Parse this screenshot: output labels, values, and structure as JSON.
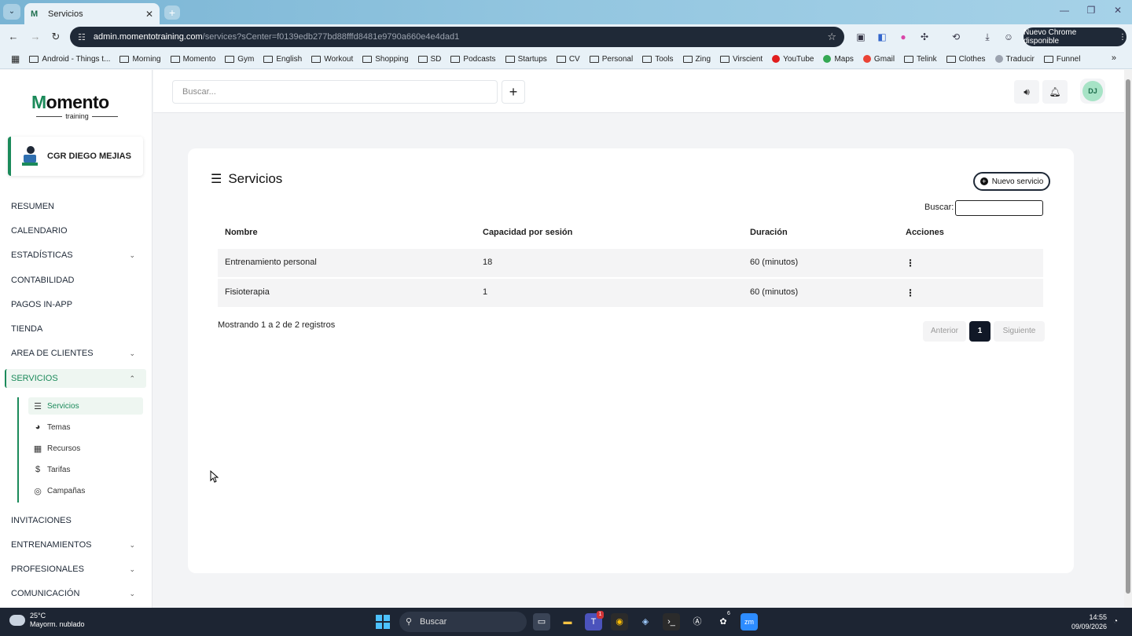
{
  "browser": {
    "tab_title": "Servicios",
    "url_host": "admin.momentotraining.com",
    "url_path": "/services?sCenter=f0139edb277bd88fffd8481e9790a660e4e4dad1",
    "update_label": "Nuevo Chrome disponible",
    "bookmarks": [
      "Android - Things t...",
      "Morning",
      "Momento",
      "Gym",
      "English",
      "Workout",
      "Shopping",
      "SD",
      "Podcasts",
      "Startups",
      "CV",
      "Personal",
      "Tools",
      "Zing",
      "Virscient",
      "YouTube",
      "Maps",
      "Gmail",
      "Telink",
      "Clothes",
      "Traducir",
      "Funnel"
    ]
  },
  "brand": {
    "logo_m": "M",
    "logo_rest": "omento",
    "logo_sub": "training"
  },
  "center": {
    "name": "CGR DIEGO MEJIAS"
  },
  "nav": {
    "resumen": "RESUMEN",
    "calendario": "CALENDARIO",
    "estadisticas": "ESTADÍSTICAS",
    "contabilidad": "CONTABILIDAD",
    "pagos": "PAGOS IN-APP",
    "tienda": "TIENDA",
    "area_clientes": "AREA DE CLIENTES",
    "servicios": "SERVICIOS",
    "invitaciones": "INVITACIONES",
    "entrenamientos": "ENTRENAMIENTOS",
    "profesionales": "PROFESIONALES",
    "comunicacion": "COMUNICACIÓN"
  },
  "subnav": {
    "servicios": "Servicios",
    "temas": "Temas",
    "recursos": "Recursos",
    "tarifas": "Tarifas",
    "campanas": "Campañas"
  },
  "header": {
    "search_placeholder": "Buscar...",
    "user_initials": "DJ"
  },
  "main": {
    "title": "Servicios",
    "new_button": "Nuevo servicio",
    "search_label": "Buscar:",
    "columns": [
      "Nombre",
      "Capacidad por sesión",
      "Duración",
      "Acciones"
    ],
    "rows": [
      {
        "nombre": "Entrenamiento personal",
        "capacidad": "18",
        "duracion": "60 (minutos)"
      },
      {
        "nombre": "Fisioterapia",
        "capacidad": "1",
        "duracion": "60 (minutos)"
      }
    ],
    "info": "Mostrando 1 a 2 de 2 registros",
    "pager": {
      "prev": "Anterior",
      "current": "1",
      "next": "Siguiente"
    }
  },
  "taskbar": {
    "temp": "25°C",
    "weather": "Mayorm. nublado",
    "search": "Buscar",
    "time": "14:55",
    "date": "09/09/2026",
    "badge_teams": "1",
    "badge_app": "6"
  },
  "colors": {
    "accent": "#1b8a5a",
    "dark": "#111827"
  }
}
